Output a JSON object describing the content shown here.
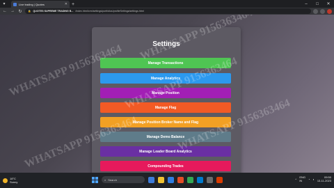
{
  "browser": {
    "tab_title": "Live trading | Quotes",
    "url_host": "QUOTES SUPREME TRADING B...",
    "url_path": "/index.html/crm/settings/portfolios/profileSettings/settings.html"
  },
  "page": {
    "title": "Settings",
    "buttons": [
      {
        "label": "Manage Transactions",
        "color": "#4fc553"
      },
      {
        "label": "Manage Analytics",
        "color": "#2c99ee"
      },
      {
        "label": "Manage Position",
        "color": "#a21fb5"
      },
      {
        "label": "Manage Flag",
        "color": "#f25a25"
      },
      {
        "label": "Manage Position Broker Name and Flag",
        "color": "#f2a024"
      },
      {
        "label": "Manage Demo Balance",
        "color": "#5f7c8a"
      },
      {
        "label": "Manage Leader Board Analytics",
        "color": "#6a2fa3"
      },
      {
        "label": "Compounding Trades",
        "color": "#e61a5c"
      }
    ]
  },
  "watermark": "WHATSAPP 9156363464",
  "taskbar": {
    "weather_temp": "18°C",
    "weather_text": "Sunny",
    "search_placeholder": "Search",
    "lang": "ENG\nIN",
    "time": "09:50",
    "date": "13-11-2023"
  }
}
